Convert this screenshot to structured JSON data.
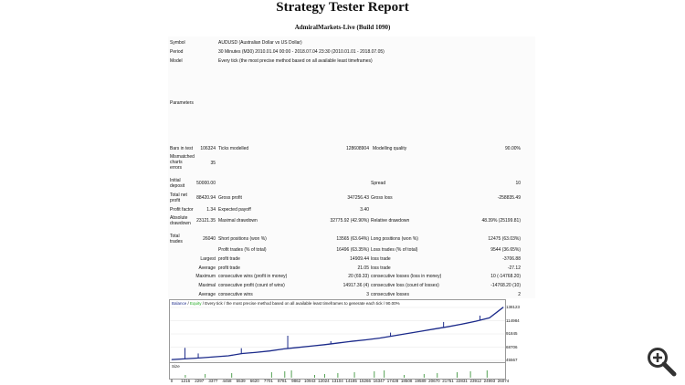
{
  "title": "Strategy Tester Report",
  "subtitle": "AdmiralMarkets-Live (Build 1090)",
  "header": {
    "symbol_label": "Symbol",
    "symbol_value": "AUDUSD (Australian Dollar vs US Dollar)",
    "period_label": "Period",
    "period_value": "30 Minutes (M30) 2010.01.04 00:00 - 2018.07.04 23:30 (2010.01.01 - 2018.07.05)",
    "model_label": "Model",
    "model_value": "Every tick (the most precise method based on all available least timeframes)",
    "parameters_label": "Parameters"
  },
  "stats": {
    "bars_label": "Bars in test",
    "bars_value": "106324",
    "ticks_label": "Ticks modelled",
    "ticks_value": "128608904",
    "quality_label": "Modelling quality",
    "quality_value": "90.00%",
    "mismatch_l1": "Mismatched",
    "mismatch_l2": "charts",
    "mismatch_l3": "errors",
    "mismatch_value": "35",
    "deposit_l1": "Initial",
    "deposit_l2": "deposit",
    "deposit_value": "50000.00",
    "spread_label": "Spread",
    "spread_value": "10",
    "netprofit_l1": "Total net",
    "netprofit_l2": "profit",
    "netprofit_value": "88420.94",
    "grossprofit_label": "Gross profit",
    "grossprofit_value": "347256.43",
    "grossloss_label": "Gross loss",
    "grossloss_value": "-258835.49",
    "pf_label": "Profit factor",
    "pf_value": "1.34",
    "ep_label": "Expected payoff",
    "ep_value": "3.40",
    "absdd_l1": "Absolute",
    "absdd_l2": "drawdown",
    "absdd_value": "23121.35",
    "maxdd_label": "Maximal drawdown",
    "maxdd_value": "32775.92 (42.90%)",
    "reldd_label": "Relative drawdown",
    "reldd_value": "48.39% (25199.81)",
    "trades_l1": "Total",
    "trades_l2": "trades",
    "trades_value": "26040",
    "short_label": "Short positions (won %)",
    "short_value": "13565 (63.64%)",
    "long_label": "Long positions (won %)",
    "long_value": "12475 (63.03%)",
    "pt_label": "Profit trades (% of total)",
    "pt_value": "16496 (63.35%)",
    "lt_label": "Loss trades (% of total)",
    "lt_value": "9544 (36.65%)",
    "largest_label": "Largest",
    "largest_profit_label": "profit trade",
    "largest_profit_value": "14909.44",
    "largest_loss_label": "loss trade",
    "largest_loss_value": "-3706.88",
    "average_label": "Average",
    "average_profit_label": "profit trade",
    "average_profit_value": "21.05",
    "average_loss_label": "loss trade",
    "average_loss_value": "-27.12",
    "maximum_label": "Maximum",
    "maxcw_label": "consecutive wins (profit in money)",
    "maxcw_value": "20 (69.33)",
    "maxcl_label": "consecutive losses (loss in money)",
    "maxcl_value": "10 (-14768.20)",
    "maximal_label": "Maximal",
    "maxcp_label": "consecutive profit (count of wins)",
    "maxcp_value": "14917.36 (4)",
    "maxcloss_label": "consecutive loss (count of losses)",
    "maxcloss_value": "-14768.20 (10)",
    "average2_label": "Average",
    "avgcw_label": "consecutive wins",
    "avgcw_value": "3",
    "avgcl_label": "consecutive losses",
    "avgcl_value": "2"
  },
  "chart_legend": {
    "balance": "Balance",
    "sep1": " / ",
    "equity": "Equity",
    "rest": " / Every tick / the most precise method based on all available least timeframes to generate each tick / 90.00%"
  },
  "chart_data": {
    "type": "line",
    "title": "",
    "xlabel": "",
    "ylabel": "",
    "series": [
      {
        "name": "Balance",
        "x": [
          0,
          1216,
          2297,
          3377,
          4458,
          5539,
          6620,
          7701,
          8781,
          9862,
          10943,
          12024,
          13104,
          14185,
          15266,
          16347,
          17428,
          18508,
          19589,
          20670,
          21751,
          22831,
          23912,
          24993,
          26074
        ],
        "values": [
          47000,
          48500,
          50000,
          51800,
          53500,
          57500,
          59500,
          62000,
          65500,
          68000,
          70500,
          73000,
          76000,
          79000,
          81500,
          84500,
          88500,
          92500,
          96500,
          100500,
          104500,
          109000,
          114000,
          120000,
          138420
        ]
      }
    ],
    "yticks": [
      "138123",
      "114984",
      "91845",
      "68706",
      "45567"
    ],
    "xticks": [
      "0",
      "1216",
      "2297",
      "3377",
      "4458",
      "5539",
      "6620",
      "7701",
      "8781",
      "9862",
      "10943",
      "12024",
      "13104",
      "14185",
      "15266",
      "16347",
      "17428",
      "18508",
      "19589",
      "20670",
      "21751",
      "22831",
      "23912",
      "24993",
      "26074"
    ],
    "ylim": [
      45567,
      138123
    ],
    "size_label": "Size",
    "colors": {
      "balance": "#1b2a8a",
      "equity": "#22aa22",
      "size": "#2a8a2a"
    }
  },
  "zoom_icon": "zoom-in-icon"
}
